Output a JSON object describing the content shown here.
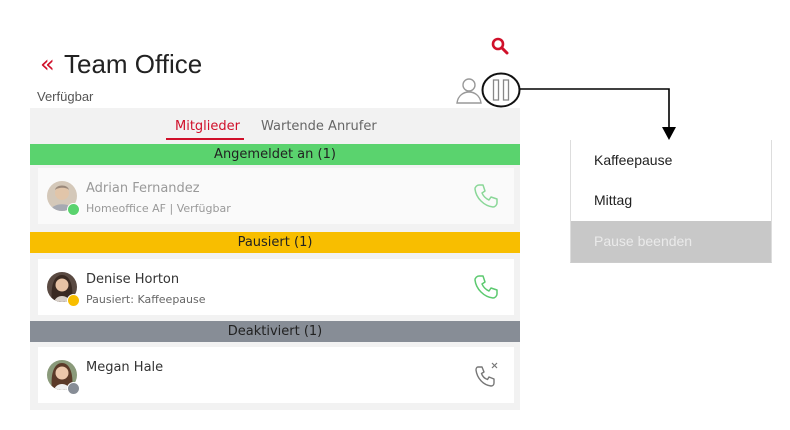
{
  "header": {
    "back_glyph": "«",
    "title": "Team Office",
    "status": "Verfügbar"
  },
  "tabs": [
    {
      "label": "Mitglieder",
      "active": true
    },
    {
      "label": "Wartende Anrufer",
      "active": false
    }
  ],
  "sections": [
    {
      "label": "Angemeldet an (1)",
      "color": "#5ad36e",
      "members": [
        {
          "name": "Adrian Fernandez",
          "detail": "Homeoffice AF | Verfügbar",
          "presence_color": "#5ad36e",
          "phone_state": "available"
        }
      ]
    },
    {
      "label": "Pausiert (1)",
      "color": "#f8be00",
      "members": [
        {
          "name": "Denise Horton",
          "detail": "Pausiert: Kaffeepause",
          "presence_color": "#f8be00",
          "phone_state": "available"
        }
      ]
    },
    {
      "label": "Deaktiviert (1)",
      "color": "#878d96",
      "members": [
        {
          "name": "Megan Hale",
          "detail": "",
          "presence_color": "#878d96",
          "phone_state": "disabled"
        }
      ]
    }
  ],
  "pause_menu": {
    "items": [
      {
        "label": "Kaffeepause",
        "enabled": true
      },
      {
        "label": "Mittag",
        "enabled": true
      },
      {
        "label": "Pause beenden",
        "enabled": false
      }
    ]
  },
  "icons": {
    "search": "search-icon",
    "person": "person-icon",
    "pause": "pause-icon",
    "phone": "phone-icon",
    "phone_disabled": "phone-disabled-icon"
  },
  "colors": {
    "accent": "#d0102a",
    "available": "#5ad36e",
    "paused": "#f8be00",
    "disabled": "#878d96",
    "phone_icon": "#5cc96f"
  }
}
